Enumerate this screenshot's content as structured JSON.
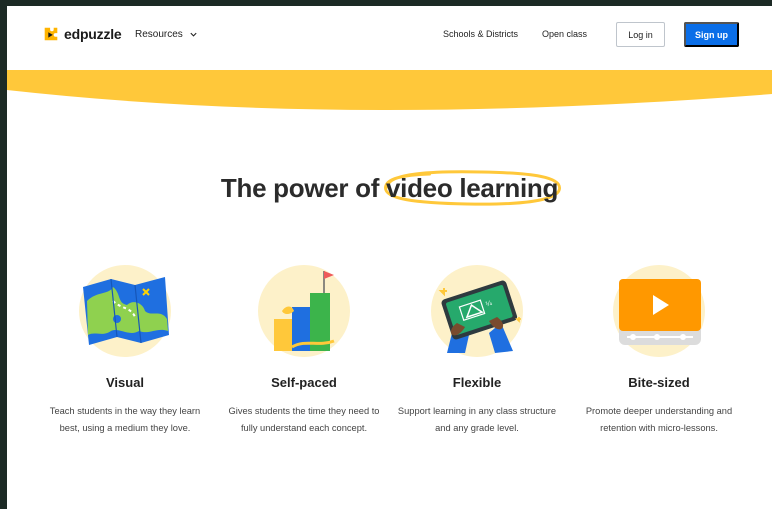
{
  "nav": {
    "logo_text": "edpuzzle",
    "resources_label": "Resources",
    "schools_label": "Schools & Districts",
    "open_class_label": "Open class",
    "login_label": "Log in",
    "signup_label": "Sign up"
  },
  "hero": {
    "heading_prefix": "The power of ",
    "heading_highlight": "video learning"
  },
  "features": [
    {
      "title": "Visual",
      "description": "Teach students in the way they learn best, using a medium they love.",
      "icon": "map-icon"
    },
    {
      "title": "Self-paced",
      "description": "Gives students the time they need to fully understand each concept.",
      "icon": "steps-flag-icon"
    },
    {
      "title": "Flexible",
      "description": "Support learning in any class structure and any grade level.",
      "icon": "tablet-hands-icon"
    },
    {
      "title": "Bite-sized",
      "description": "Promote deeper understanding and retention with micro-lessons.",
      "icon": "video-player-icon"
    }
  ],
  "colors": {
    "accent_yellow": "#ffc83a",
    "brand_blue": "#0a6ee8",
    "circle_bg": "#fdf1c9",
    "page_bg": "#ffffff",
    "frame_bg": "#1c2a25"
  }
}
